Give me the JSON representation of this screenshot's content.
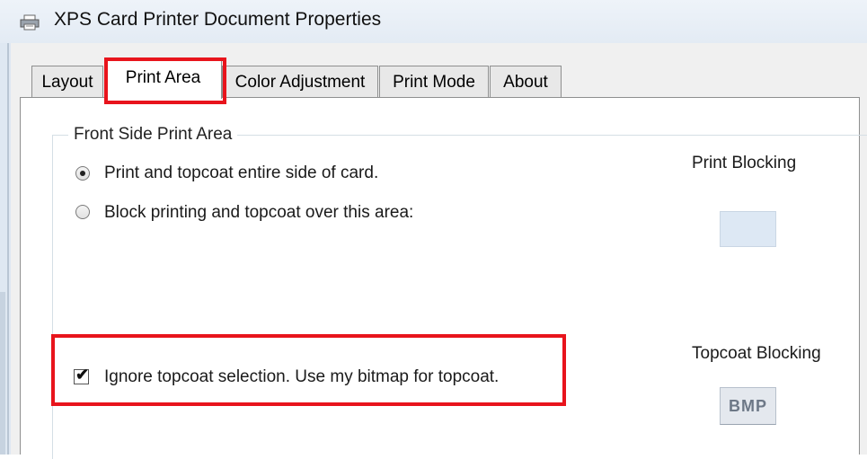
{
  "window": {
    "title": "XPS Card Printer Document Properties",
    "icon": "printer-icon"
  },
  "tabs": [
    {
      "label": "Layout",
      "active": false
    },
    {
      "label": "Print Area",
      "active": true
    },
    {
      "label": "Color Adjustment",
      "active": false
    },
    {
      "label": "Print Mode",
      "active": false
    },
    {
      "label": "About",
      "active": false
    }
  ],
  "front_side": {
    "group_title": "Front Side Print Area",
    "options": [
      {
        "label": "Print and topcoat entire side of card.",
        "selected": true
      },
      {
        "label": "Block printing and topcoat over this area:",
        "selected": false
      }
    ]
  },
  "print_blocking": {
    "label": "Print Blocking"
  },
  "topcoat_blocking": {
    "label": "Topcoat Blocking",
    "button_label": "BMP"
  },
  "ignore_topcoat": {
    "label": "Ignore topcoat selection.  Use my bitmap for topcoat.",
    "checked": true,
    "check_glyph": "✔"
  },
  "colors": {
    "highlight": "#e8141c",
    "swatch": "#dde8f4"
  }
}
